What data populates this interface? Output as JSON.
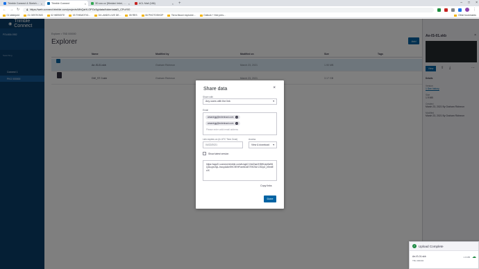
{
  "browser": {
    "tabs": [
      {
        "label": "Trimble Connect & SketchUp Wo",
        "active": false,
        "color": "#1a73e8"
      },
      {
        "label": "Trimble Connect",
        "active": true,
        "color": "#0063a3"
      },
      {
        "label": "3D.coc.cz [Hledání řešní, řešení",
        "active": false,
        "color": "#34a853"
      },
      {
        "label": "ACL Mail (186)",
        "active": false,
        "color": "#c5221f"
      }
    ],
    "new_tab": "+",
    "url": "https://web.connect.trimble.com/projects/MhQaHl-OPOv3g/data/folder/wiaiD_CPuY00",
    "bookmarks": [
      "01 sbleeped",
      "21 GESTIONS",
      "02 WEBSITE",
      "03 THKMOTIO...",
      "04 LANDS LIVE DE...",
      "05 RES",
      "06 PHOTOSHOP",
      "Terra Mooni exploree...",
      "Outlook + free pers...",
      "Other bookmarks"
    ]
  },
  "sidebar": {
    "brand": "Trimble Connect",
    "project_label": "POLABA 1982",
    "section_label": "Searching",
    "items": [
      {
        "label": "Connect 1",
        "active": false
      },
      {
        "label": "PKG 000000",
        "active": true
      }
    ]
  },
  "main": {
    "breadcrumb": "Explorer > TBD 000000",
    "title": "Explorer",
    "add_label": "Add",
    "columns": {
      "name": "Name",
      "modified_by": "Modified by",
      "modified_on": "Modified on",
      "size": "Size",
      "tags": "Tags"
    },
    "rows": [
      {
        "name": "Ae-IS-01.skb",
        "modified_by": "Graham Richmon",
        "modified_on": "March 23, 2021",
        "size": "1.90 MB",
        "selected": true
      },
      {
        "name": "DW_ST-3.skb",
        "modified_by": "Graham Richmon",
        "modified_on": "March 23, 2021",
        "size": "3.17 GB",
        "selected": false
      }
    ]
  },
  "right_panel": {
    "title": "Ae-IS-01.skb",
    "view_label": "View",
    "details_label": "Details",
    "version_label": "Version",
    "version_value": "1 See history",
    "size_label": "Size",
    "size_value": "1.9 MB",
    "created_label": "Created",
    "created_value": "March 23, 2021 By Graham Richmon",
    "modified_label": "Modified",
    "modified_value": "March 23, 2021 By Graham Richmon"
  },
  "upload": {
    "title": "Upload Complete",
    "file": "Ae-IS-01.skb",
    "destination": "TBL 000000",
    "size": "1.9 MB"
  },
  "modal": {
    "title": "Share data",
    "share_with_label": "Share with",
    "share_with_value": "Any users with the link",
    "email_label": "Email",
    "emails": [
      "amanirgg@enterinact.com",
      "amanirgg@enterinact.com"
    ],
    "email_placeholder": "Please enter valid email address",
    "expiry_label": "Link expires on (in UTC Time Zone)",
    "expiry_value": "04/22/2021",
    "access_label": "Access",
    "access_value": "View & download",
    "show_latest_label": "Show latest version",
    "link": "https://app21.connect.trimble.com/tc/api/2.0/s/l2aeJH3lfKxep9aS6Q2ucyxchyL-fsxcyAAtvEHC9EHFamN1kE7EKGW-CSDp2_e5rntEcIX",
    "copy_link_label": "Copy links",
    "done_label": "Done"
  }
}
